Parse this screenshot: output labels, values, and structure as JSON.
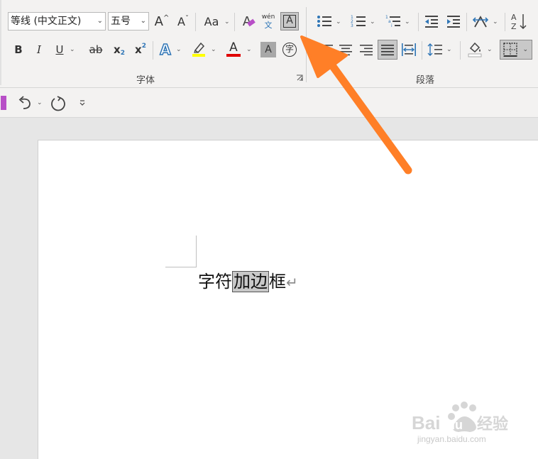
{
  "ribbon": {
    "font_group": {
      "label": "字体",
      "font_name": "等线 (中文正文)",
      "font_size": "五号",
      "grow_font": "A",
      "shrink_font": "A",
      "change_case": "Aa",
      "clear_format": "A",
      "phonetic_top": "wén",
      "phonetic_bottom": "文",
      "char_border": "A",
      "bold": "B",
      "italic": "I",
      "underline": "U",
      "strike": "ab",
      "subscript": "x",
      "superscript": "x",
      "sub_small": "2",
      "sup_small": "2",
      "text_effects": "A",
      "font_color": "A",
      "char_shading": "A",
      "enclose_char": "字"
    },
    "paragraph_group": {
      "label": "段落"
    },
    "colors": {
      "highlight": "#ffff00",
      "font_color": "#e00000",
      "text_effect": "#2e75b6"
    }
  },
  "document": {
    "text_before": "字符",
    "text_boxed": "加边",
    "text_after": "框",
    "para_mark": "↵"
  },
  "watermark": {
    "site": "jingyan.baidu.com"
  }
}
